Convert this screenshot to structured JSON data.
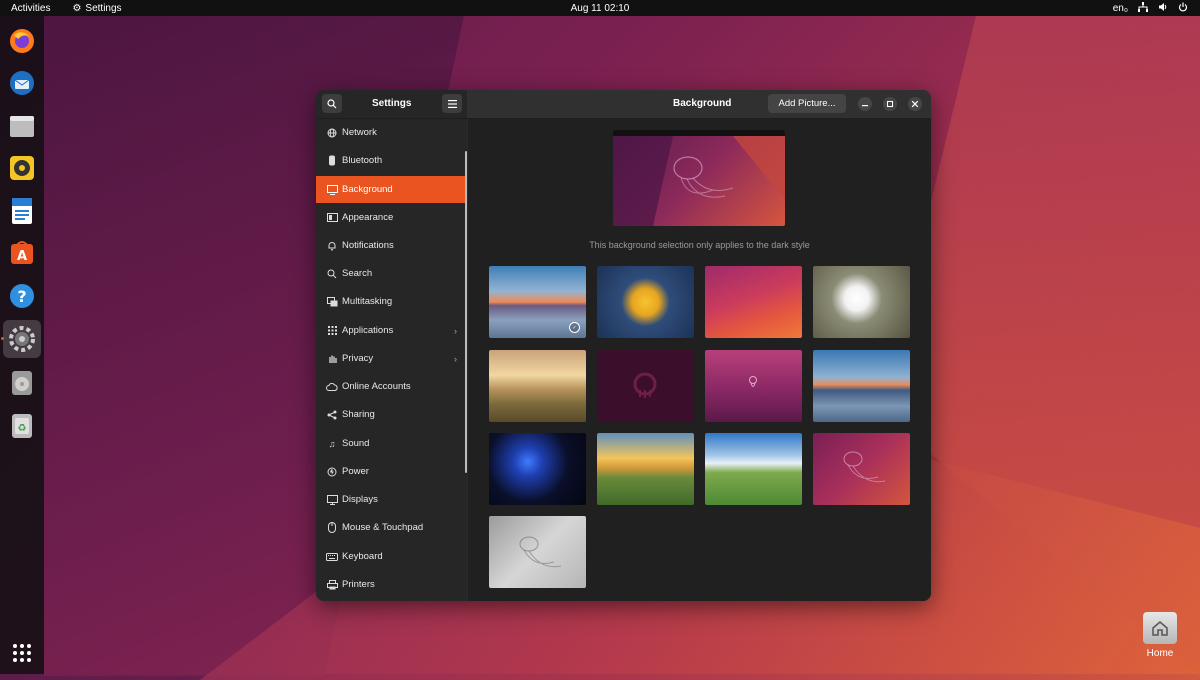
{
  "topbar": {
    "activities": "Activities",
    "app_name": "Settings",
    "clock": "Aug 11  02:10",
    "lang": "en₀"
  },
  "dock": {
    "items": [
      "firefox",
      "thunderbird",
      "files",
      "rhythmbox",
      "libreoffice-writer",
      "app-center",
      "help",
      "settings",
      "disc",
      "trash"
    ],
    "show_apps": "apps-grid"
  },
  "window": {
    "sidebar_title": "Settings",
    "page_title": "Background",
    "add_picture": "Add Picture...",
    "sidebar": [
      {
        "label": "Network",
        "icon": "globe-icon"
      },
      {
        "label": "Bluetooth",
        "icon": "bluetooth-icon"
      },
      {
        "label": "Background",
        "icon": "monitor-icon",
        "selected": true
      },
      {
        "label": "Appearance",
        "icon": "palette-icon"
      },
      {
        "label": "Notifications",
        "icon": "bell-icon"
      },
      {
        "label": "Search",
        "icon": "search-icon"
      },
      {
        "label": "Multitasking",
        "icon": "windows-icon"
      },
      {
        "label": "Applications",
        "icon": "grid-icon",
        "arrow": true
      },
      {
        "label": "Privacy",
        "icon": "hand-icon",
        "arrow": true
      },
      {
        "label": "Online Accounts",
        "icon": "cloud-icon"
      },
      {
        "label": "Sharing",
        "icon": "share-icon"
      },
      {
        "label": "Sound",
        "icon": "music-icon"
      },
      {
        "label": "Power",
        "icon": "power-icon"
      },
      {
        "label": "Displays",
        "icon": "display-icon"
      },
      {
        "label": "Mouse & Touchpad",
        "icon": "mouse-icon"
      },
      {
        "label": "Keyboard",
        "icon": "keyboard-icon"
      },
      {
        "label": "Printers",
        "icon": "printer-icon"
      }
    ],
    "caption": "This background selection only applies to the dark style",
    "wallpapers": [
      {
        "name": "lake-sunset",
        "selected": true
      },
      {
        "name": "sunflower"
      },
      {
        "name": "orange-purple-gradient"
      },
      {
        "name": "white-blossoms"
      },
      {
        "name": "golden-field-sunset"
      },
      {
        "name": "dark-jellyfish-logo"
      },
      {
        "name": "purple-jellyfish"
      },
      {
        "name": "calm-lake-dusk"
      },
      {
        "name": "blue-jellyfish-dark"
      },
      {
        "name": "green-hills-sunrise"
      },
      {
        "name": "green-fields-clouds"
      },
      {
        "name": "jellyfish-purple-orange"
      },
      {
        "name": "grey-jellyfish"
      }
    ]
  },
  "desktop": {
    "home_label": "Home"
  }
}
